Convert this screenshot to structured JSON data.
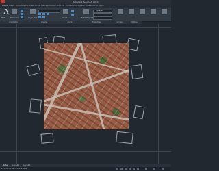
{
  "window": {
    "title": "Autodesk AutoCAD 2020"
  },
  "ribbon_tabs": [
    "Home",
    "Insert",
    "Annotate",
    "Parametric",
    "View",
    "Manage",
    "Output",
    "Add-ins",
    "Collaborate",
    "Express Tools",
    "Featured Apps"
  ],
  "ribbon_panels": {
    "annotation": "Annotation",
    "layers": "Layers",
    "block": "Block",
    "properties": "Properties",
    "groups": "Groups",
    "utilities": "Utilities"
  },
  "ribbon_tools": {
    "text": "Text",
    "dimension": "Dimension",
    "layer_properties": "Layer Properties",
    "insert": "Insert",
    "match_properties": "Match Properties",
    "bylayer": "ByLayer"
  },
  "layout_tabs": [
    "Model",
    "Layout1",
    "Layout2"
  ],
  "status": {
    "coordinates": "1234.5678, 987.6543, 0.0000"
  },
  "colors": {
    "background": "#212830",
    "ribbon": "#323a44",
    "accent": "#4d8ac2"
  }
}
